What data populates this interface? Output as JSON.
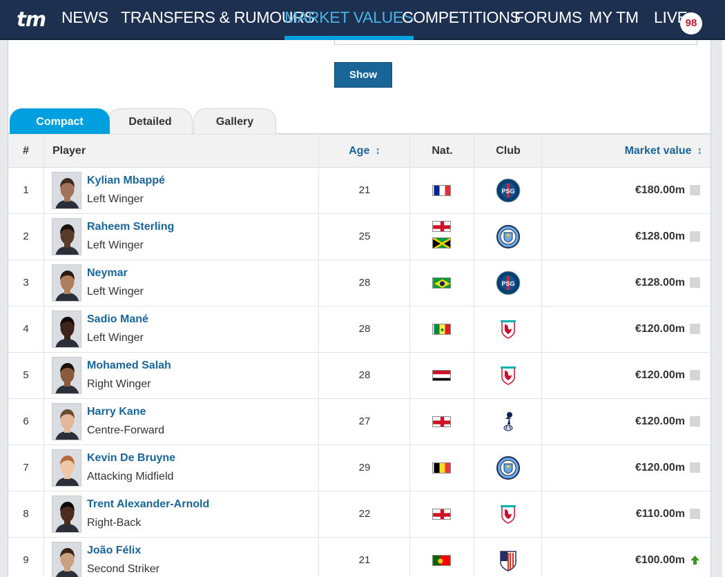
{
  "nav": {
    "logo": "tm",
    "items": [
      "NEWS",
      "TRANSFERS & RUMOURS",
      "MARKET VALUES",
      "COMPETITIONS",
      "FORUMS",
      "MY TM",
      "LIVE"
    ],
    "active": "MARKET VALUES",
    "live_count": "98"
  },
  "filter": {
    "show_label": "Show"
  },
  "tabs": [
    "Compact",
    "Detailed",
    "Gallery"
  ],
  "table": {
    "headers": {
      "num": "#",
      "player": "Player",
      "age": "Age",
      "nat": "Nat.",
      "club": "Club",
      "value": "Market value"
    },
    "rows": [
      {
        "num": "1",
        "name": "Kylian Mbappé",
        "position": "Left Winger",
        "age": "21",
        "nationality": [
          "France"
        ],
        "club": "psg-icon",
        "value": "€180.00m",
        "trend": "unchanged"
      },
      {
        "num": "2",
        "name": "Raheem Sterling",
        "position": "Left Winger",
        "age": "25",
        "nationality": [
          "England",
          "Jamaica"
        ],
        "club": "man-city-icon",
        "value": "€128.00m",
        "trend": "unchanged"
      },
      {
        "num": "3",
        "name": "Neymar",
        "position": "Left Winger",
        "age": "28",
        "nationality": [
          "Brazil"
        ],
        "club": "psg-icon",
        "value": "€128.00m",
        "trend": "unchanged"
      },
      {
        "num": "4",
        "name": "Sadio Mané",
        "position": "Left Winger",
        "age": "28",
        "nationality": [
          "Senegal"
        ],
        "club": "liverpool-icon",
        "value": "€120.00m",
        "trend": "unchanged"
      },
      {
        "num": "5",
        "name": "Mohamed Salah",
        "position": "Right Winger",
        "age": "28",
        "nationality": [
          "Egypt"
        ],
        "club": "liverpool-icon",
        "value": "€120.00m",
        "trend": "unchanged"
      },
      {
        "num": "6",
        "name": "Harry Kane",
        "position": "Centre-Forward",
        "age": "27",
        "nationality": [
          "England"
        ],
        "club": "tottenham-icon",
        "value": "€120.00m",
        "trend": "unchanged"
      },
      {
        "num": "7",
        "name": "Kevin De Bruyne",
        "position": "Attacking Midfield",
        "age": "29",
        "nationality": [
          "Belgium"
        ],
        "club": "man-city-icon",
        "value": "€120.00m",
        "trend": "unchanged"
      },
      {
        "num": "8",
        "name": "Trent Alexander-Arnold",
        "position": "Right-Back",
        "age": "22",
        "nationality": [
          "England"
        ],
        "club": "liverpool-icon",
        "value": "€110.00m",
        "trend": "unchanged"
      },
      {
        "num": "9",
        "name": "João Félix",
        "position": "Second Striker",
        "age": "21",
        "nationality": [
          "Portugal"
        ],
        "club": "atletico-icon",
        "value": "€100.00m",
        "trend": "up"
      }
    ]
  },
  "colors": {
    "nav_bg": "#1d3050",
    "accent": "#00a0e0",
    "link": "#1a6598",
    "trend_up": "#3c9a1e",
    "trend_unchanged": "#d6d6d6"
  }
}
